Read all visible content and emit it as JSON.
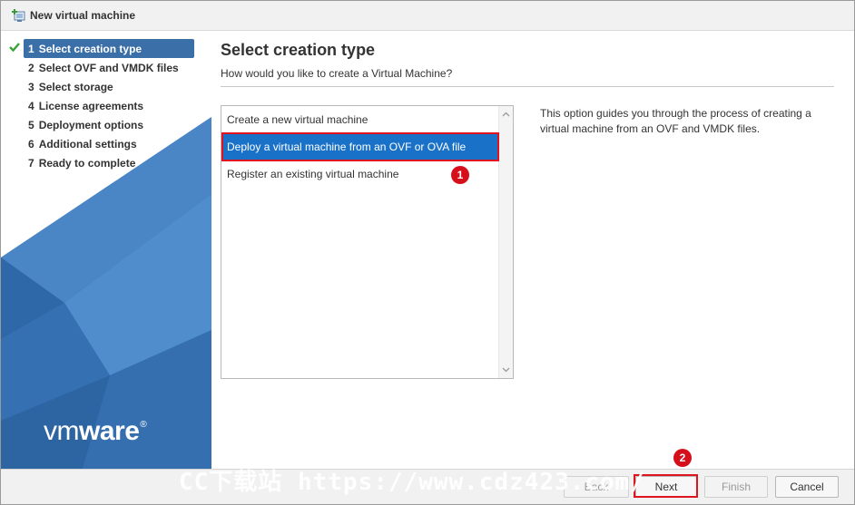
{
  "window": {
    "title": "New virtual machine",
    "icon": "new-vm-icon"
  },
  "steps": [
    {
      "num": "1",
      "label": "Select creation type",
      "active": true,
      "completed": true
    },
    {
      "num": "2",
      "label": "Select OVF and VMDK files",
      "active": false
    },
    {
      "num": "3",
      "label": "Select storage",
      "active": false
    },
    {
      "num": "4",
      "label": "License agreements",
      "active": false
    },
    {
      "num": "5",
      "label": "Deployment options",
      "active": false
    },
    {
      "num": "6",
      "label": "Additional settings",
      "active": false
    },
    {
      "num": "7",
      "label": "Ready to complete",
      "active": false
    }
  ],
  "logo": {
    "text_light": "vm",
    "text_bold": "ware",
    "reg": "®"
  },
  "main": {
    "title": "Select creation type",
    "subtitle": "How would you like to create a Virtual Machine?",
    "options": [
      {
        "label": "Create a new virtual machine",
        "selected": false
      },
      {
        "label": "Deploy a virtual machine from an OVF or OVA file",
        "selected": true
      },
      {
        "label": "Register an existing virtual machine",
        "selected": false
      }
    ],
    "description": "This option guides you through the process of creating a virtual machine from an OVF and VMDK files."
  },
  "annotations": {
    "badge1": "1",
    "badge2": "2"
  },
  "buttons": {
    "back": "Back",
    "next": "Next",
    "finish": "Finish",
    "cancel": "Cancel"
  },
  "watermark": "CC下载站 https://www.cdz423.com/",
  "colors": {
    "accent": "#3a6fa8",
    "selection": "#1a72c8",
    "annotation": "#e0141e",
    "sidebar_blue": "#3b78bb"
  }
}
